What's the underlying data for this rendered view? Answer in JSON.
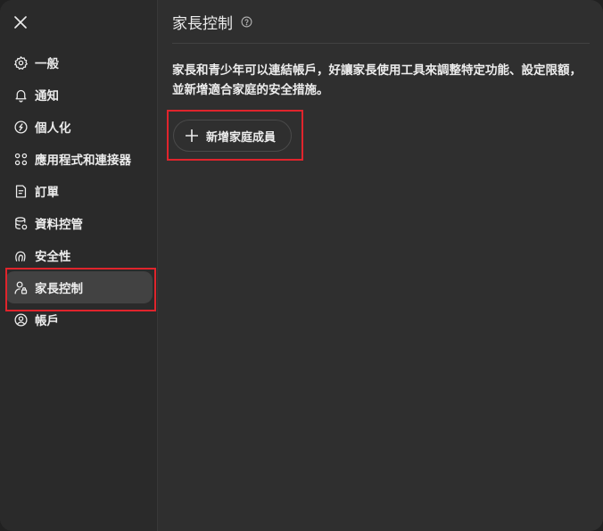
{
  "window": {
    "accent_highlight": "#e0242c"
  },
  "close_icon": "close-icon",
  "sidebar": {
    "items": [
      {
        "label": "一般",
        "icon": "gear-icon",
        "active": false
      },
      {
        "label": "通知",
        "icon": "bell-icon",
        "active": false
      },
      {
        "label": "個人化",
        "icon": "personalization-icon",
        "active": false
      },
      {
        "label": "應用程式和連接器",
        "icon": "apps-icon",
        "active": false
      },
      {
        "label": "訂單",
        "icon": "orders-icon",
        "active": false
      },
      {
        "label": "資料控管",
        "icon": "database-icon",
        "active": false
      },
      {
        "label": "安全性",
        "icon": "security-icon",
        "active": false
      },
      {
        "label": "家長控制",
        "icon": "parental-control-icon",
        "active": true
      },
      {
        "label": "帳戶",
        "icon": "account-icon",
        "active": false
      }
    ]
  },
  "main": {
    "title": "家長控制",
    "description": "家長和青少年可以連結帳戶，好讓家長使用工具來調整特定功能、設定限額，並新增適合家庭的安全措施。",
    "add_button_label": "新增家庭成員"
  }
}
